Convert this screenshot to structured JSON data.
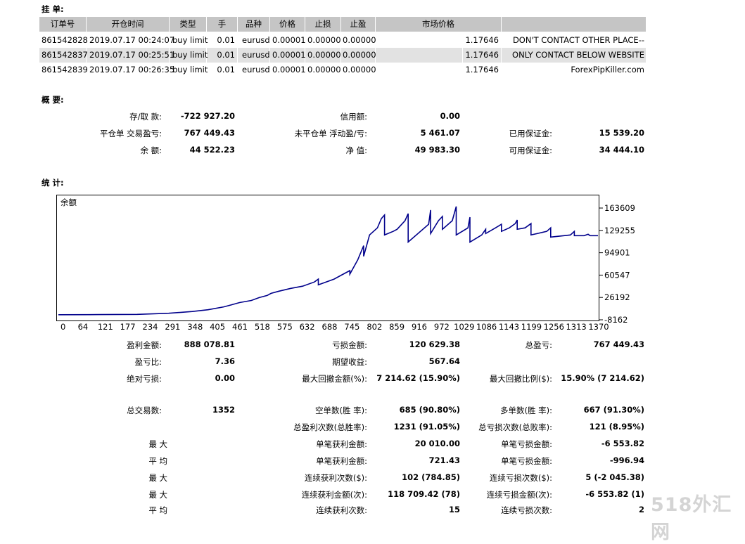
{
  "orders": {
    "section_title": "挂 单:",
    "headers": [
      "订单号",
      "开仓时间",
      "类型",
      "手",
      "品种",
      "价格",
      "止损",
      "止盈",
      "市场价格",
      ""
    ],
    "rows": [
      {
        "ticket": "861542828",
        "time": "2019.07.17 00:24:07",
        "type": "buy limit",
        "lots": "0.01",
        "symbol": "eurusd",
        "price": "0.00001",
        "sl": "0.00000",
        "tp": "0.00000",
        "market": "1.17646",
        "comment": "DON'T CONTACT OTHER PLACE--"
      },
      {
        "ticket": "861542837",
        "time": "2019.07.17 00:25:51",
        "type": "buy limit",
        "lots": "0.01",
        "symbol": "eurusd",
        "price": "0.00001",
        "sl": "0.00000",
        "tp": "0.00000",
        "market": "1.17646",
        "comment": "ONLY CONTACT BELOW WEBSITE"
      },
      {
        "ticket": "861542839",
        "time": "2019.07.17 00:26:35",
        "type": "buy limit",
        "lots": "0.01",
        "symbol": "eurusd",
        "price": "0.00001",
        "sl": "0.00000",
        "tp": "0.00000",
        "market": "1.17646",
        "comment": "ForexPipKiller.com"
      }
    ]
  },
  "summary": {
    "section_title": "概 要:",
    "deposit_label": "存/取 款:",
    "deposit_value": "-722 927.20",
    "credit_label": "信用额:",
    "credit_value": "0.00",
    "closed_pl_label": "平仓单 交易盈亏:",
    "closed_pl_value": "767 449.43",
    "floating_pl_label": "未平仓单 浮动盈/亏:",
    "floating_pl_value": "5 461.07",
    "margin_label": "已用保证金:",
    "margin_value": "15 539.20",
    "balance_label": "余 额:",
    "balance_value": "44 522.23",
    "equity_label": "净 值:",
    "equity_value": "49 983.30",
    "free_margin_label": "可用保证金:",
    "free_margin_value": "34 444.10"
  },
  "stats": {
    "section_title": "统 计:",
    "rows": [
      {
        "l1": "盈利金额:",
        "v1": "888 078.81",
        "l2": "亏损金额:",
        "v2": "120 629.38",
        "l3": "总盈亏:",
        "v3": "767 449.43"
      },
      {
        "l1": "盈亏比:",
        "v1": "7.36",
        "l2": "期望收益:",
        "v2": "567.64",
        "l3": "",
        "v3": ""
      },
      {
        "l1": "绝对亏损:",
        "v1": "0.00",
        "l2": "最大回撤金额(%):",
        "v2": "7 214.62 (15.90%)",
        "l3": "最大回撤比例($):",
        "v3": "15.90% (7 214.62)"
      },
      {
        "l1": "总交易数:",
        "v1": "1352",
        "l2": "空单数(胜 率):",
        "v2": "685 (90.80%)",
        "l3": "多单数(胜 率):",
        "v3": "667 (91.30%)"
      },
      {
        "l1": "",
        "v1": "",
        "l2": "总盈利次数(总胜率):",
        "v2": "1231 (91.05%)",
        "l3": "总亏损次数(总败率):",
        "v3": "121 (8.95%)"
      },
      {
        "l1": "最 大",
        "v1": "",
        "l2": "单笔获利金额:",
        "v2": "20 010.00",
        "l3": "单笔亏损金额:",
        "v3": "-6 553.82"
      },
      {
        "l1": "平 均",
        "v1": "",
        "l2": "单笔获利金额:",
        "v2": "721.43",
        "l3": "单笔亏损金额:",
        "v3": "-996.94"
      },
      {
        "l1": "最 大",
        "v1": "",
        "l2": "连续获利次数($):",
        "v2": "102 (784.85)",
        "l3": "连续亏损次数($):",
        "v3": "5 (-2 045.38)"
      },
      {
        "l1": "最 大",
        "v1": "",
        "l2": "连续获利金额(次):",
        "v2": "118 709.42 (78)",
        "l3": "连续亏损金额(次):",
        "v3": "-6 553.82 (1)"
      },
      {
        "l1": "平 均",
        "v1": "",
        "l2": "连续获利次数:",
        "v2": "15",
        "l3": "连续亏损次数:",
        "v3": "2"
      }
    ]
  },
  "chart_data": {
    "type": "line",
    "title": "余额",
    "line_color": "#00008b",
    "x_ticks": [
      "0",
      "64",
      "121",
      "177",
      "234",
      "291",
      "348",
      "405",
      "461",
      "518",
      "575",
      "632",
      "688",
      "745",
      "802",
      "859",
      "916",
      "972",
      "1029",
      "1086",
      "1143",
      "1199",
      "1256",
      "1313",
      "1370"
    ],
    "y_ticks": [
      "163609",
      "129255",
      "94901",
      "60547",
      "26192",
      "-8162"
    ],
    "ylim": [
      -8162,
      163609
    ],
    "xlim": [
      0,
      1370
    ],
    "series": [
      {
        "x": [
          0,
          100,
          200,
          280,
          340,
          380,
          420,
          440,
          460,
          490,
          510,
          530,
          540,
          560,
          590,
          620,
          650,
          660,
          660,
          700,
          720,
          740,
          740,
          760,
          775,
          775,
          790,
          810,
          820,
          828,
          828,
          850,
          860,
          880,
          888,
          888,
          940,
          945,
          945,
          965,
          975,
          975,
          1000,
          1010,
          1010,
          1040,
          1045,
          1045,
          1075,
          1085,
          1085,
          1110,
          1125,
          1125,
          1145,
          1160,
          1165,
          1165,
          1185,
          1200,
          1200,
          1240,
          1250,
          1250,
          1300,
          1310,
          1310,
          1335,
          1345,
          1350,
          1370
        ],
        "y": [
          -2000,
          -1800,
          -1500,
          0,
          2500,
          5000,
          9000,
          12000,
          15000,
          18000,
          22000,
          25000,
          28000,
          31000,
          35000,
          38000,
          44000,
          48000,
          40000,
          48000,
          54000,
          60000,
          55000,
          75000,
          95000,
          80000,
          110000,
          120000,
          133000,
          138000,
          110000,
          115000,
          118000,
          130000,
          140000,
          100000,
          125000,
          145000,
          112000,
          130000,
          136000,
          118000,
          130000,
          150000,
          110000,
          120000,
          135000,
          100000,
          110000,
          118000,
          112000,
          120000,
          125000,
          115000,
          120000,
          126000,
          131000,
          118000,
          120000,
          126000,
          110000,
          115000,
          120000,
          107000,
          110000,
          115000,
          109000,
          109000,
          111000,
          109000,
          109000
        ]
      }
    ]
  }
}
